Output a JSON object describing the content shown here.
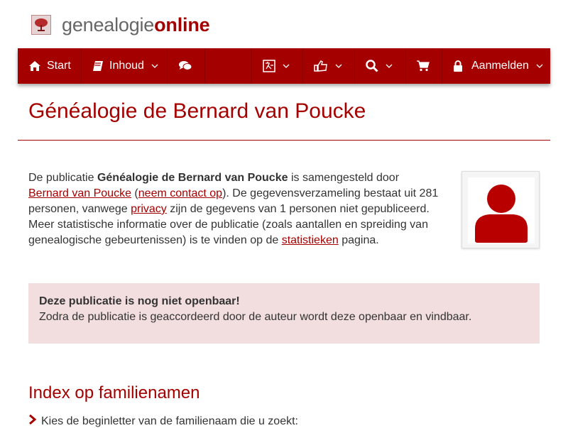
{
  "header": {
    "logo_part1": "genealogie",
    "logo_part2": "online"
  },
  "nav": {
    "start": "Start",
    "inhoud": "Inhoud",
    "login": "Aanmelden"
  },
  "page": {
    "title": "Généalogie de Bernard van Poucke"
  },
  "intro": {
    "t1": "De publicatie ",
    "pub_name": "Généalogie de Bernard van Poucke",
    "t2": " is samengesteld door ",
    "author_link": "Bernard van Poucke",
    "t3": " (",
    "contact_link": "neem contact op",
    "t4": "). De gegevensverzameling bestaat uit 281 personen, vanwege ",
    "privacy_link": "privacy",
    "t5": " zijn de gegevens van 1 personen niet gepubliceerd. Meer statistische informatie over de publicatie (zoals aantallen en spreiding van genealogische gebeurtenissen) is te vinden op de ",
    "stats_link": "statistieken",
    "t6": " pagina."
  },
  "alert": {
    "title": "Deze publicatie is nog niet openbaar!",
    "body": "Zodra de publicatie is geaccordeerd door de auteur wordt deze openbaar en vindbaar."
  },
  "index": {
    "title": "Index op familienamen",
    "instruction": "Kies de beginletter van de familienaam die u zoekt:"
  },
  "colors": {
    "brand": "#a50000",
    "alert_bg": "#f2dede"
  },
  "icons": [
    "tree-icon",
    "home-icon",
    "book-icon",
    "comments-icon",
    "translate-icon",
    "thumbs-up-icon",
    "search-icon",
    "cart-icon",
    "lock-icon",
    "chevron-down-icon",
    "user-icon",
    "chevron-right-icon"
  ]
}
